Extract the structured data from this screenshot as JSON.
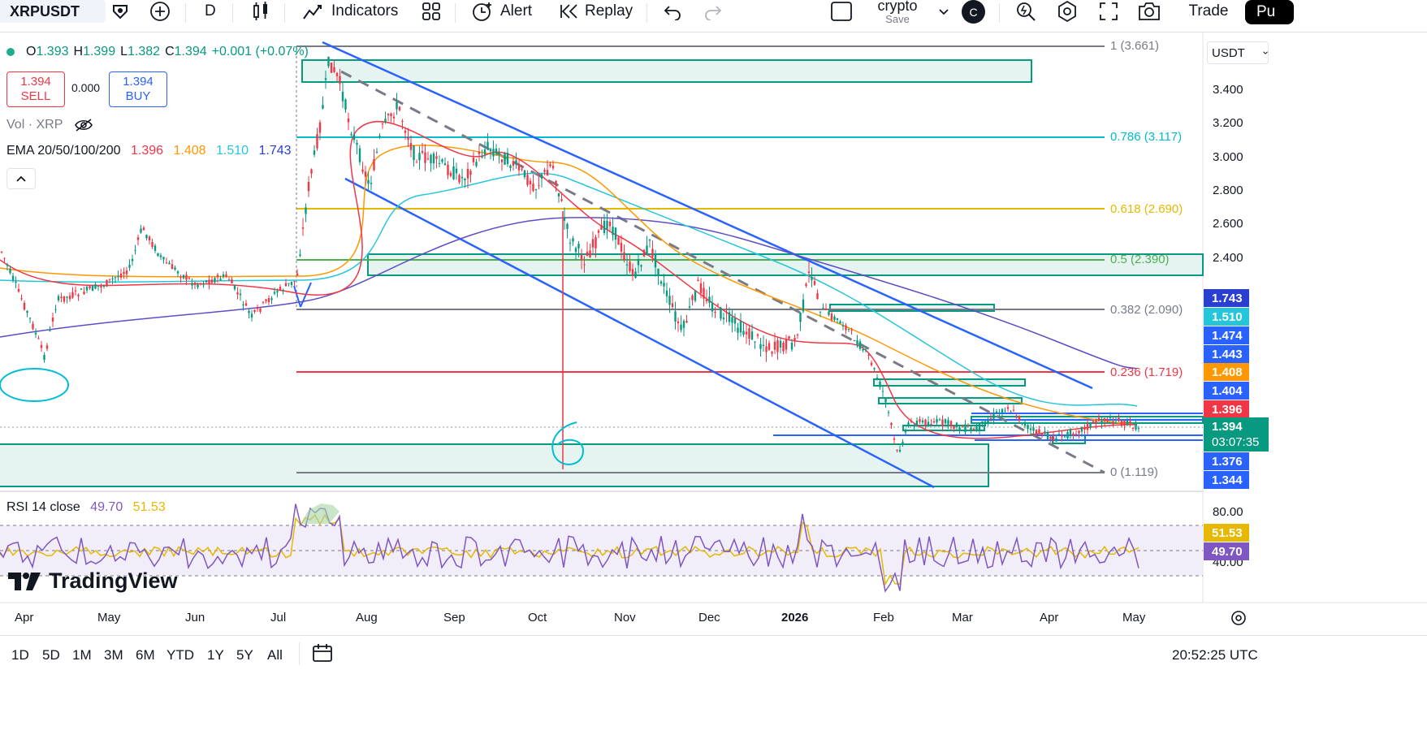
{
  "toolbar": {
    "symbol": "XRPUSDT",
    "interval": "D",
    "indicators_label": "Indicators",
    "alert_label": "Alert",
    "replay_label": "Replay",
    "layout_name": "crypto",
    "layout_save": "Save",
    "avatar_letter": "C",
    "trade_label": "Trade",
    "publish_label": "Pu"
  },
  "legend": {
    "o_label": "O",
    "o_value": "1.393",
    "h_label": "H",
    "h_value": "1.399",
    "l_label": "L",
    "l_value": "1.382",
    "c_label": "C",
    "c_value": "1.394",
    "change": "+0.001 (+0.07%)",
    "sell_price": "1.394",
    "sell_label": "SELL",
    "spread": "0.000",
    "buy_price": "1.394",
    "buy_label": "BUY",
    "vol_label": "Vol · XRP",
    "ema_label": "EMA 20/50/100/200",
    "ema20": "1.396",
    "ema50": "1.408",
    "ema100": "1.510",
    "ema200": "1.743",
    "rsi_label": "RSI 14 close",
    "rsi_value": "49.70",
    "rsi_ma": "51.53"
  },
  "price_scale": {
    "currency": "USDT",
    "labels": [
      "3.400",
      "3.200",
      "3.000",
      "2.800",
      "2.600",
      "2.400"
    ],
    "rsi_labels": [
      "80.00",
      "40.00"
    ],
    "tags": [
      {
        "value": "1.743",
        "color": "#2a3fcf"
      },
      {
        "value": "1.510",
        "color": "#26c6da"
      },
      {
        "value": "1.474",
        "color": "#2962ff"
      },
      {
        "value": "1.443",
        "color": "#2962ff"
      },
      {
        "value": "1.408",
        "color": "#ff9800"
      },
      {
        "value": "1.404",
        "color": "#2962ff"
      },
      {
        "value": "1.396",
        "color": "#f23645"
      },
      {
        "value": "1.376",
        "color": "#2962ff"
      },
      {
        "value": "1.344",
        "color": "#2962ff"
      }
    ],
    "last_price": "1.394",
    "countdown": "03:07:35",
    "rsi_tag_ma": "51.53",
    "rsi_tag_value": "49.70"
  },
  "fib_labels": [
    {
      "text": "1 (3.661)",
      "color": "#787b86"
    },
    {
      "text": "0.786 (3.117)",
      "color": "#00bcd4"
    },
    {
      "text": "0.618 (2.690)",
      "color": "#e6b800"
    },
    {
      "text": "0.5 (2.390)",
      "color": "#4caf50"
    },
    {
      "text": "0.382 (2.090)",
      "color": "#787b86"
    },
    {
      "text": "0.236 (1.719)",
      "color": "#f23645"
    },
    {
      "text": "0 (1.119)",
      "color": "#787b86"
    }
  ],
  "annotation_text": "6",
  "time_axis": [
    "Apr",
    "May",
    "Jun",
    "Jul",
    "Aug",
    "Sep",
    "Oct",
    "Nov",
    "Dec",
    "2026",
    "Feb",
    "Mar",
    "Apr",
    "May"
  ],
  "ranges": [
    "1D",
    "5D",
    "1M",
    "3M",
    "6M",
    "YTD",
    "1Y",
    "5Y",
    "All"
  ],
  "clock": "20:52:25 UTC",
  "brand": "TradingView",
  "colors": {
    "up": "#089981",
    "down": "#f23645",
    "accent": "#2962ff"
  }
}
